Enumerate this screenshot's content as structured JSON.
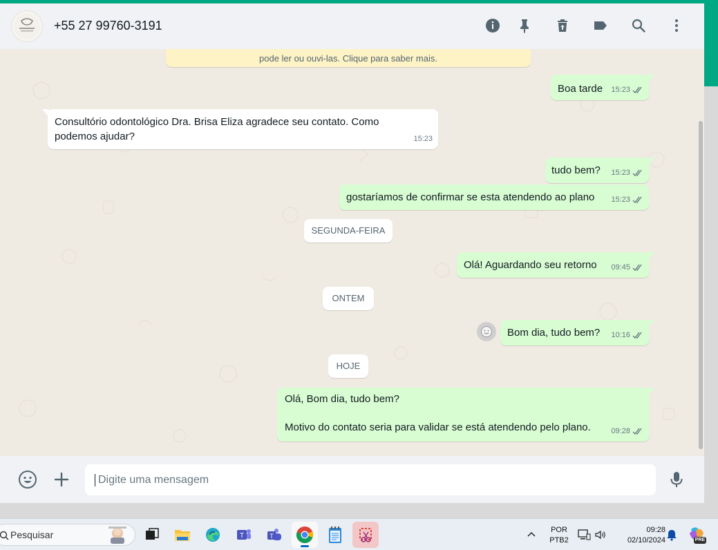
{
  "header": {
    "contact_name": "+55 27 99760-3191",
    "avatar_label": "Consultório odontológico",
    "icons": [
      "info-icon",
      "pin-icon",
      "delete-icon",
      "label-icon",
      "search-icon",
      "menu-icon"
    ]
  },
  "chat": {
    "notice_text": "pode ler ou ouvi-las. Clique para saber mais.",
    "messages": [
      {
        "direction": "out",
        "text": "Boa tarde",
        "time": "15:23",
        "status": "read"
      },
      {
        "direction": "in",
        "text": "Consultório odontológico Dra. Brisa Eliza agradece seu contato. Como podemos ajudar?",
        "time": "15:23"
      },
      {
        "direction": "out",
        "text": "tudo bem?",
        "time": "15:23",
        "status": "read"
      },
      {
        "direction": "out",
        "text": "gostaríamos de confirmar se esta atendendo ao plano",
        "time": "15:23",
        "status": "read"
      },
      {
        "direction": "out",
        "text": "Olá! Aguardando seu retorno",
        "time": "09:45",
        "status": "read"
      },
      {
        "direction": "out",
        "text": "Bom dia, tudo bem?",
        "time": "10:16",
        "status": "read"
      },
      {
        "direction": "out",
        "text_line1": "Olá, Bom dia, tudo bem?",
        "text_line2": "Motivo do contato seria para validar se está atendendo pelo plano.",
        "time": "09:28",
        "status": "read"
      }
    ],
    "date_chips": [
      "SEGUNDA-FEIRA",
      "ONTEM",
      "HOJE"
    ]
  },
  "composer": {
    "placeholder": "Digite uma mensagem"
  },
  "taskbar": {
    "search_label": "Pesquisar",
    "lang_line1": "POR",
    "lang_line2": "PTB2",
    "time": "09:28",
    "date": "02/10/2024",
    "copilot_badge": "PRE"
  },
  "colors": {
    "accent": "#00a884",
    "outgoing": "#d9fdd3",
    "incoming": "#ffffff",
    "chat_bg": "#efeae2",
    "read_ticks": "#667781"
  }
}
